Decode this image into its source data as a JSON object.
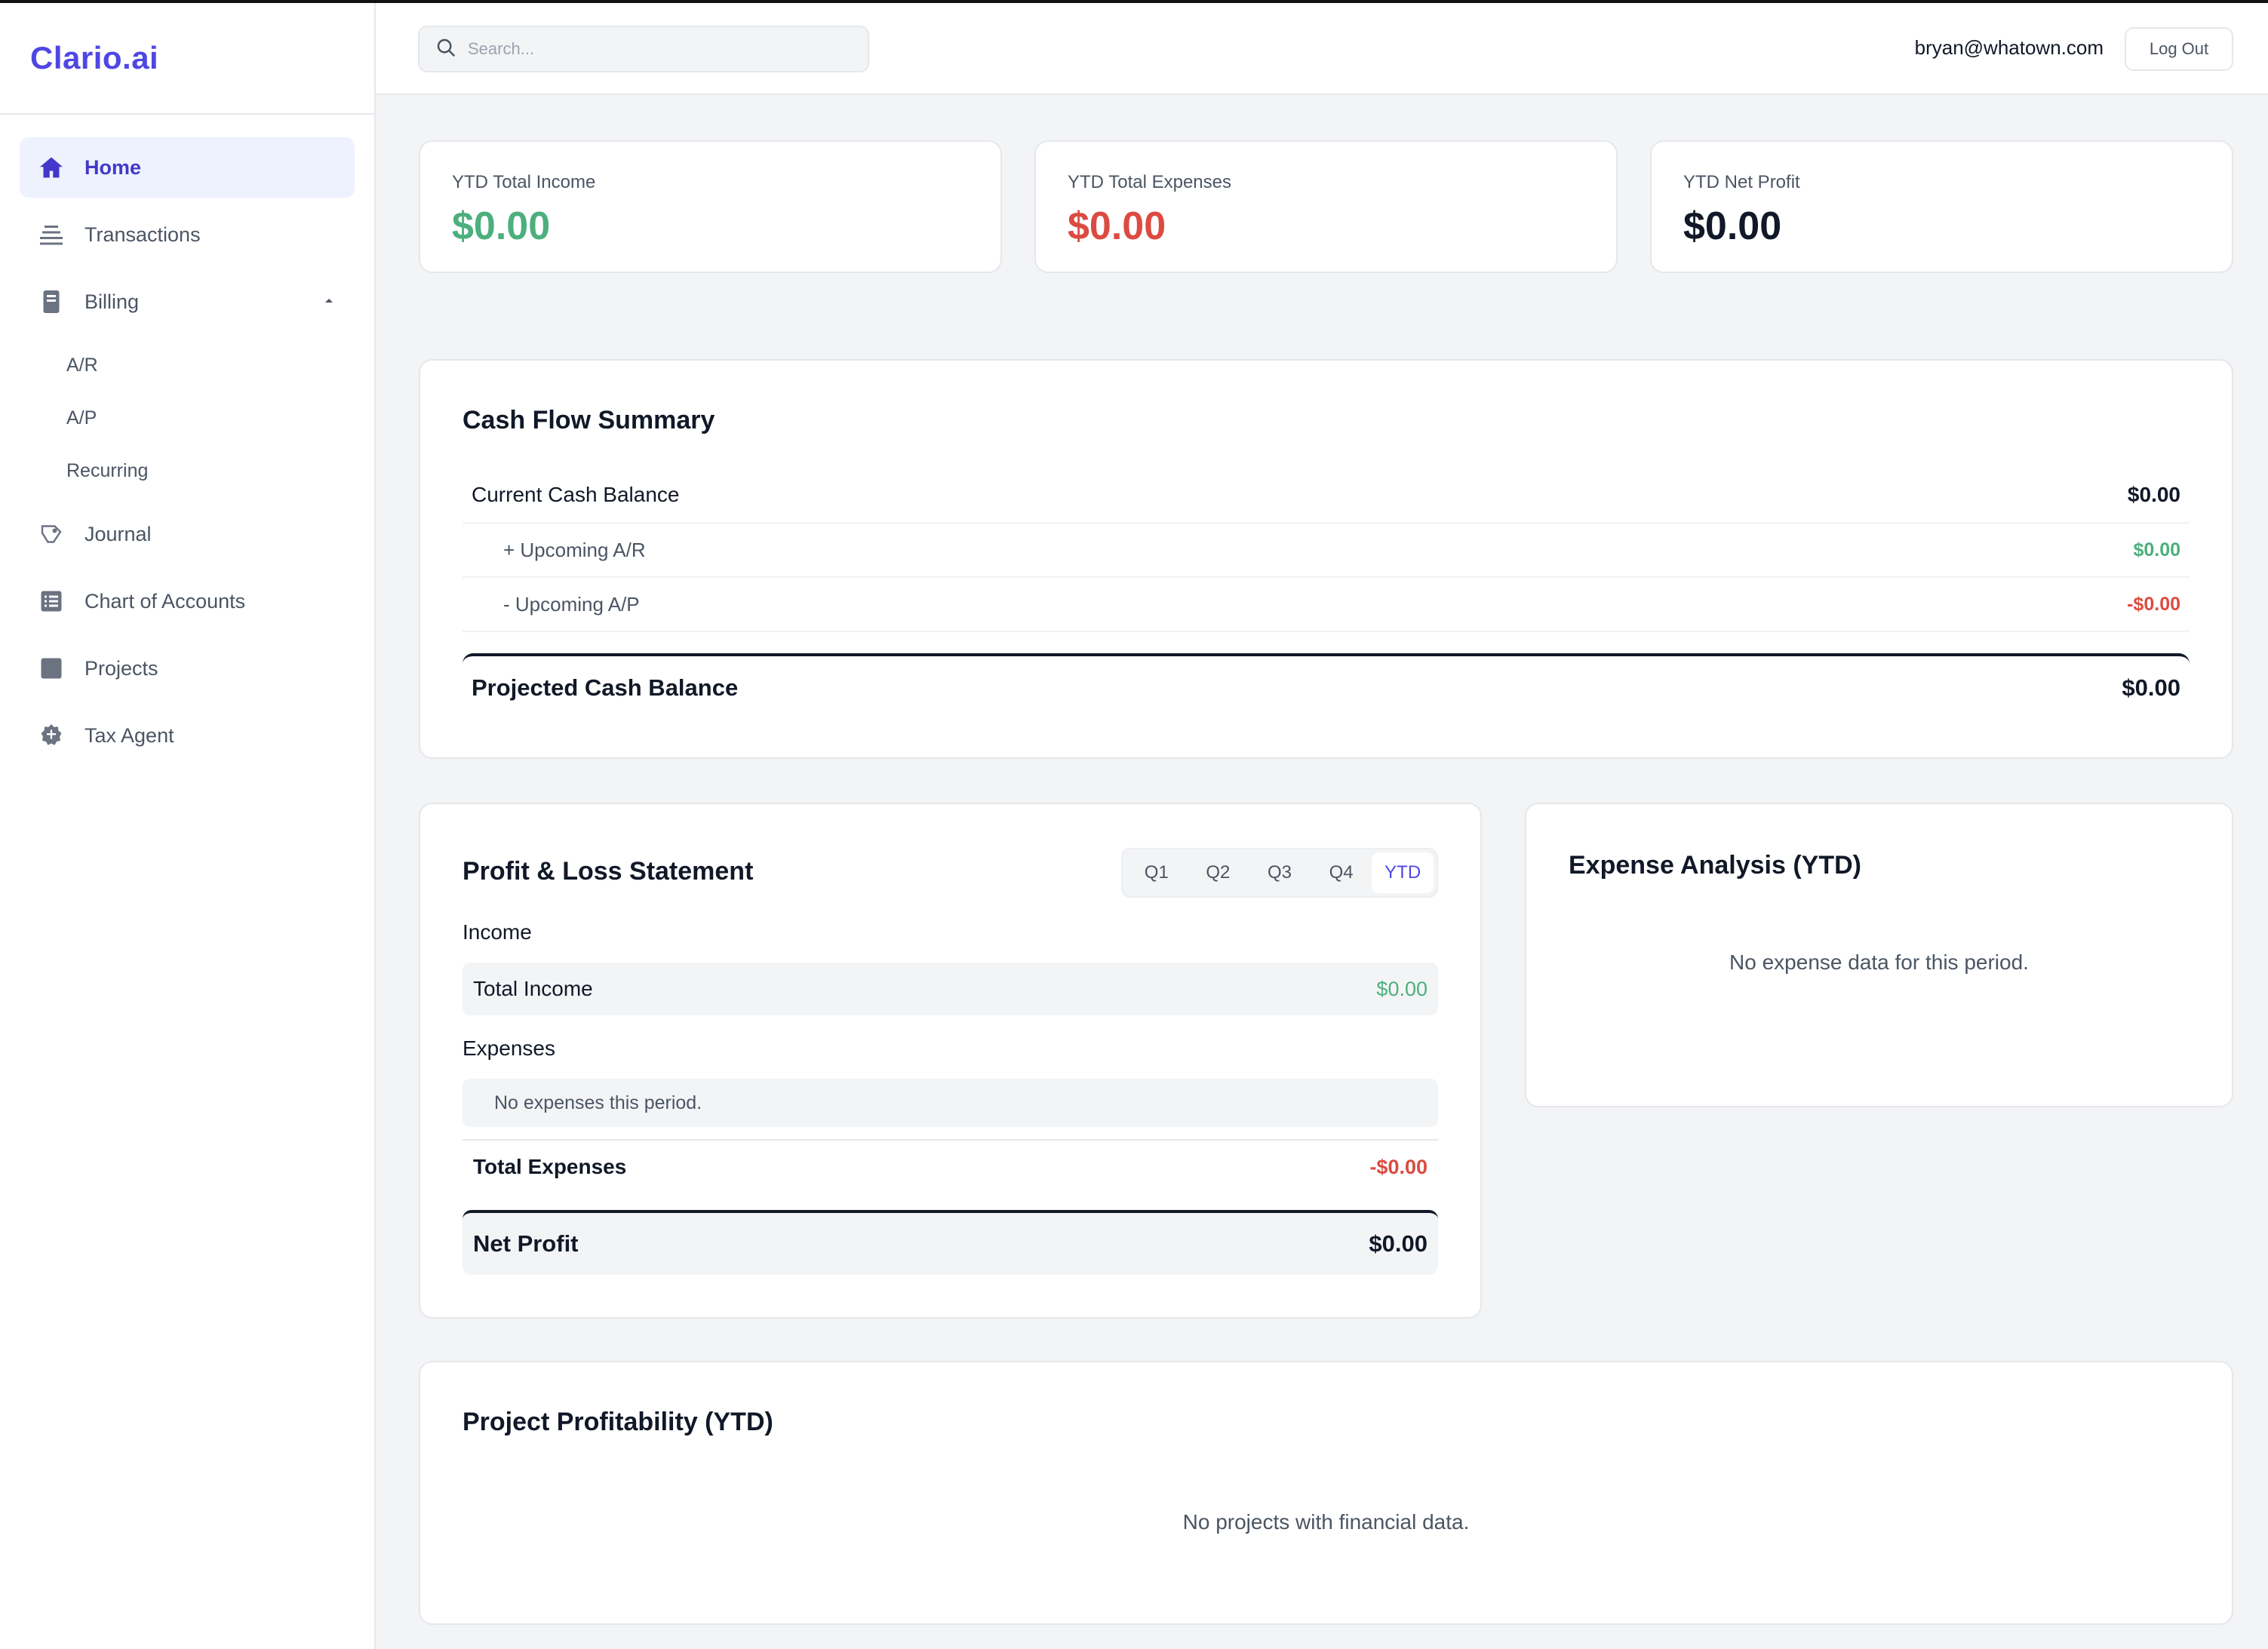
{
  "app": {
    "brand": "Clario.ai"
  },
  "sidebar": {
    "items": [
      {
        "label": "Home",
        "icon": "home-icon"
      },
      {
        "label": "Transactions",
        "icon": "transactions-icon"
      },
      {
        "label": "Billing",
        "icon": "billing-icon"
      },
      {
        "label": "Journal",
        "icon": "journal-icon"
      },
      {
        "label": "Chart of Accounts",
        "icon": "chart-of-accounts-icon"
      },
      {
        "label": "Projects",
        "icon": "projects-icon"
      },
      {
        "label": "Tax Agent",
        "icon": "tax-agent-icon"
      }
    ],
    "billing_subitems": [
      "A/R",
      "A/P",
      "Recurring"
    ],
    "active": "Home"
  },
  "topbar": {
    "search_placeholder": "Search...",
    "user_email": "bryan@whatown.com",
    "logout_label": "Log Out"
  },
  "stats": [
    {
      "label": "YTD Total Income",
      "value": "$0.00"
    },
    {
      "label": "YTD Total Expenses",
      "value": "$0.00"
    },
    {
      "label": "YTD Net Profit",
      "value": "$0.00"
    }
  ],
  "cash_flow": {
    "title": "Cash Flow Summary",
    "current_label": "Current Cash Balance",
    "current_value": "$0.00",
    "upcoming_ar_label": "+ Upcoming A/R",
    "upcoming_ar_value": "$0.00",
    "upcoming_ap_label": "- Upcoming A/P",
    "upcoming_ap_value": "-$0.00",
    "projected_label": "Projected Cash Balance",
    "projected_value": "$0.00"
  },
  "pnl": {
    "title": "Profit & Loss Statement",
    "periods": [
      "Q1",
      "Q2",
      "Q3",
      "Q4",
      "YTD"
    ],
    "active_period": "YTD",
    "income_heading": "Income",
    "total_income_label": "Total Income",
    "total_income_value": "$0.00",
    "expenses_heading": "Expenses",
    "no_expenses": "No expenses this period.",
    "total_expenses_label": "Total Expenses",
    "total_expenses_value": "-$0.00",
    "net_profit_label": "Net Profit",
    "net_profit_value": "$0.00"
  },
  "expense_analysis": {
    "title": "Expense Analysis (YTD)",
    "empty": "No expense data for this period."
  },
  "project_profitability": {
    "title": "Project Profitability (YTD)",
    "empty": "No projects with financial data."
  },
  "colors": {
    "accent": "#4f46e5",
    "income": "#4caf7d",
    "expense": "#dc4b41"
  }
}
